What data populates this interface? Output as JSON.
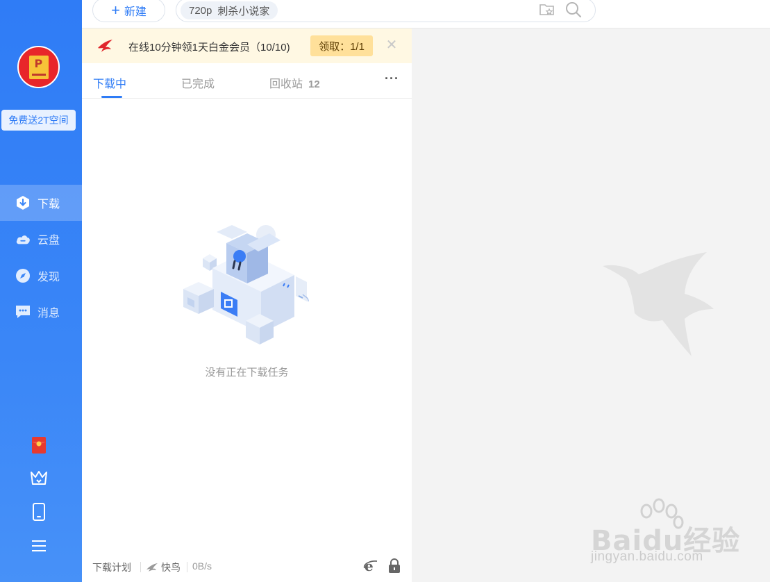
{
  "topbar": {
    "new_label": "新建",
    "search_chip_quality": "720p",
    "search_chip_text": "刺杀小说家"
  },
  "sidebar": {
    "promo": "免费送2T空间",
    "items": [
      {
        "label": "下载",
        "icon": "download-icon",
        "active": true
      },
      {
        "label": "云盘",
        "icon": "cloud-icon",
        "active": false
      },
      {
        "label": "发现",
        "icon": "compass-icon",
        "active": false
      },
      {
        "label": "消息",
        "icon": "message-icon",
        "active": false
      }
    ],
    "bottom_icons": [
      "red-envelope-icon",
      "crown-icon",
      "phone-icon",
      "menu-icon"
    ]
  },
  "banner": {
    "text": "在线10分钟领1天白金会员（10/10)",
    "claim": "领取：1/1",
    "close": "✕"
  },
  "tabs": [
    {
      "label": "下载中",
      "active": true
    },
    {
      "label": "已完成",
      "active": false
    },
    {
      "label": "回收站",
      "count": "12",
      "active": false
    }
  ],
  "more": "···",
  "empty_state": "没有正在下载任务",
  "statusbar": {
    "plan": "下载计划",
    "fast": "快鸟",
    "speed": "0B/s"
  },
  "watermark": {
    "brand": "Baidu经验",
    "url": "jingyan.baidu.com"
  },
  "colors": {
    "accent": "#2f7cf6",
    "banner_bg": "#fff8e3",
    "claim_bg": "#ffe09a"
  }
}
